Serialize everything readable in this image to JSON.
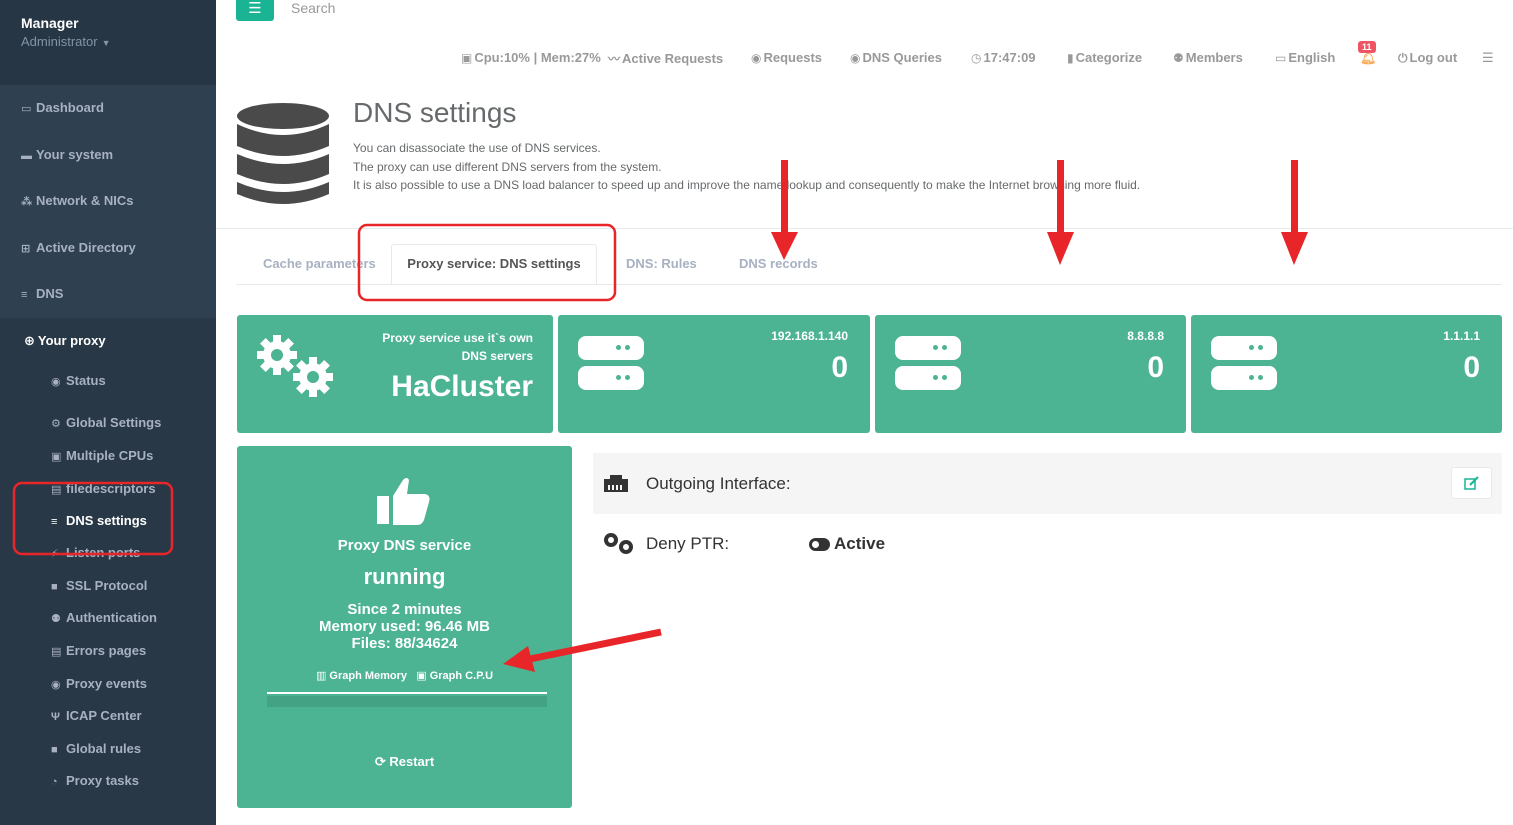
{
  "sidebar": {
    "profile": {
      "name": "Manager",
      "role": "Administrator"
    },
    "items": [
      {
        "label": "Dashboard"
      },
      {
        "label": "Your system"
      },
      {
        "label": "Network & NICs"
      },
      {
        "label": "Active Directory"
      },
      {
        "label": "DNS"
      }
    ],
    "proxy": {
      "title": "Your proxy",
      "items": [
        {
          "label": "Status"
        },
        {
          "label": "Global Settings"
        },
        {
          "label": "Multiple CPUs"
        },
        {
          "label": "filedescriptors"
        },
        {
          "label": "DNS settings"
        },
        {
          "label": "Listen ports"
        },
        {
          "label": "SSL Protocol"
        },
        {
          "label": "Authentication"
        },
        {
          "label": "Errors pages"
        },
        {
          "label": "Proxy events"
        },
        {
          "label": "ICAP Center"
        },
        {
          "label": "Global rules"
        },
        {
          "label": "Proxy tasks"
        }
      ]
    }
  },
  "topbar": {
    "menu_icon": "☰",
    "search_placeholder": "Search",
    "stats": "Cpu:10% | Mem:27%",
    "active_requests": "Active Requests",
    "requests": "Requests",
    "dns_queries": "DNS Queries",
    "time": "17:47:09",
    "categorize": "Categorize",
    "members": "Members",
    "language": "English",
    "notifications": "11",
    "logout": "Log out"
  },
  "header": {
    "title": "DNS settings",
    "lines": [
      "You can disassociate the use of DNS services.",
      "The proxy can use different DNS servers from the system.",
      "It is also possible to use a DNS load balancer to speed up and improve the name lookup and consequently to make the Internet browsing more fluid."
    ]
  },
  "tabs": [
    {
      "label": "Cache parameters"
    },
    {
      "label": "Proxy service: DNS settings"
    },
    {
      "label": "DNS: Rules"
    },
    {
      "label": "DNS records"
    }
  ],
  "widgets": {
    "main": {
      "label_line1": "Proxy service use it`s own",
      "label_line2": "DNS servers",
      "value": "HaCluster"
    },
    "servers": [
      {
        "ip": "192.168.1.140",
        "count": "0"
      },
      {
        "ip": "8.8.8.8",
        "count": "0"
      },
      {
        "ip": "1.1.1.1",
        "count": "0"
      }
    ]
  },
  "status": {
    "title": "Proxy DNS service",
    "state": "running",
    "since": "Since 2 minutes",
    "memory": "Memory used: 96.46 MB",
    "files": "Files: 88/34624",
    "graph_memory": "Graph Memory",
    "graph_cpu": "Graph C.P.U",
    "restart": "Restart"
  },
  "settings": {
    "outgoing_label": "Outgoing Interface:",
    "deny_label": "Deny PTR:",
    "deny_value": "Active"
  },
  "colors": {
    "accent": "#1ab394",
    "widget": "#4cb393",
    "sidebar": "#2f4050",
    "annotation": "#e8262a"
  }
}
